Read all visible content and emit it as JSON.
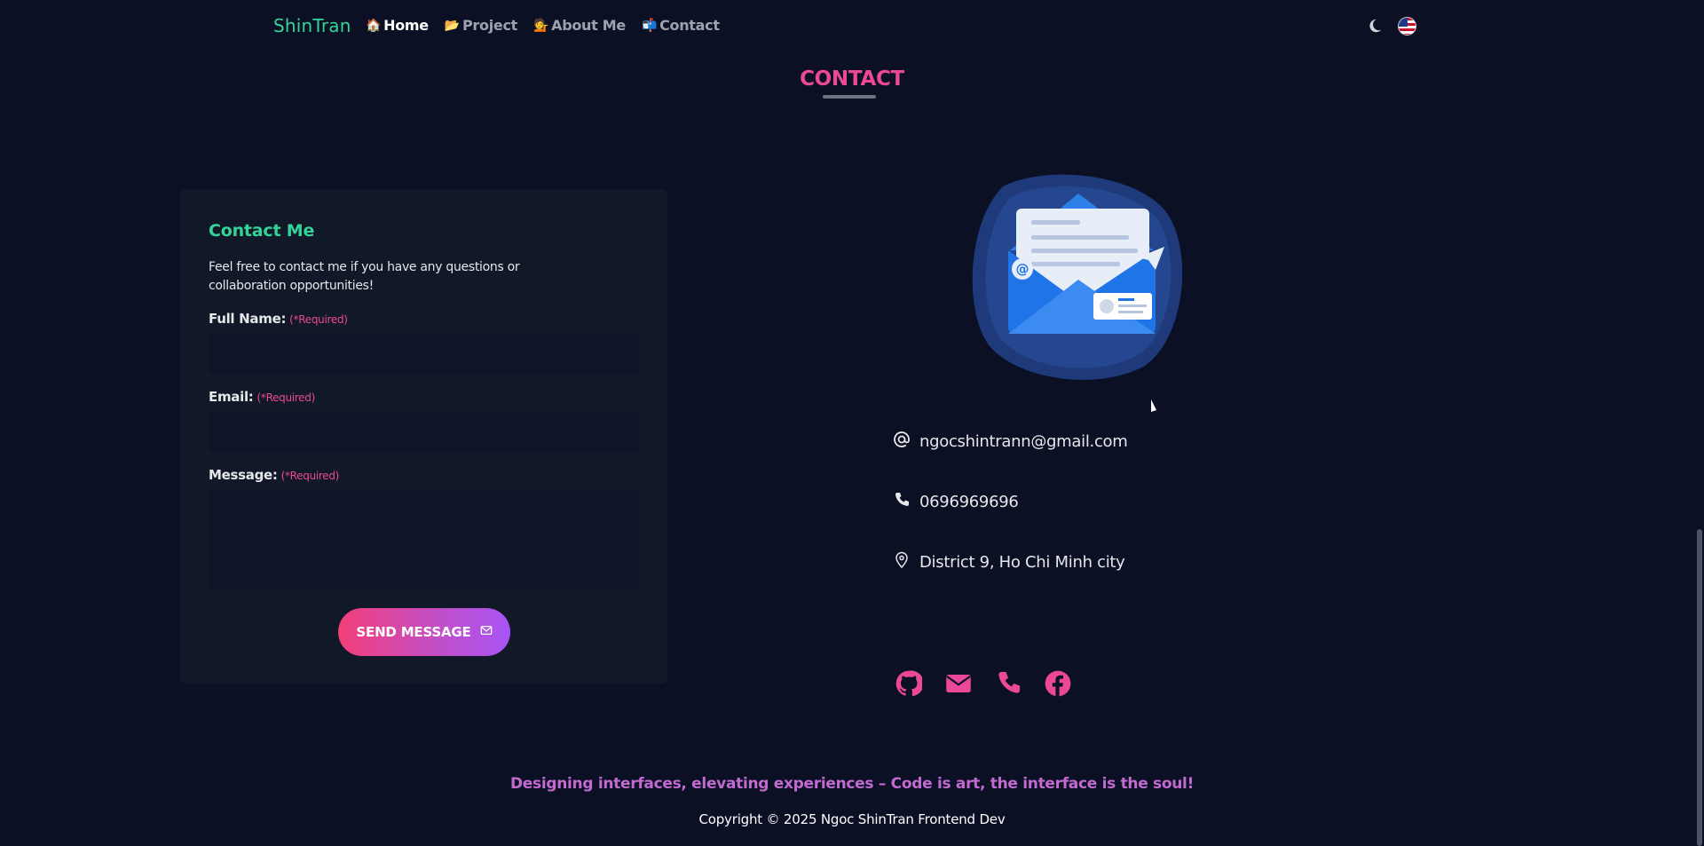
{
  "nav": {
    "brand": "ShinTran",
    "links": [
      {
        "emoji": "🏠",
        "label": "Home"
      },
      {
        "emoji": "📂",
        "label": "Project"
      },
      {
        "emoji": "💁",
        "label": "About Me"
      },
      {
        "emoji": "📬",
        "label": "Contact"
      }
    ],
    "theme_icon": "moon-icon",
    "language_icon": "us-flag-icon"
  },
  "section": {
    "title": "CONTACT"
  },
  "form": {
    "title": "Contact Me",
    "description": "Feel free to contact me if you have any questions or collaboration opportunities!",
    "required_text": "(*Required)",
    "fields": {
      "full_name": {
        "label": "Full Name:",
        "value": ""
      },
      "email": {
        "label": "Email:",
        "value": ""
      },
      "message": {
        "label": "Message:",
        "value": ""
      }
    },
    "submit_label": "SEND MESSAGE",
    "submit_icon": "mail-icon"
  },
  "contact_info": {
    "email": "ngocshintrann@gmail.com",
    "phone": "0696969696",
    "address": "District 9, Ho Chi Minh city"
  },
  "socials": [
    "github-icon",
    "envelope-icon",
    "phone-icon",
    "facebook-icon"
  ],
  "footer": {
    "tagline": "Designing interfaces, elevating experiences – Code is art, the interface is the soul!",
    "copyright": "Copyright © 2025 Ngoc ShinTran Frontend Dev"
  },
  "colors": {
    "background": "#0b1024",
    "accent_pink": "#ec4899",
    "accent_green": "#34d399",
    "card": "#111827"
  }
}
